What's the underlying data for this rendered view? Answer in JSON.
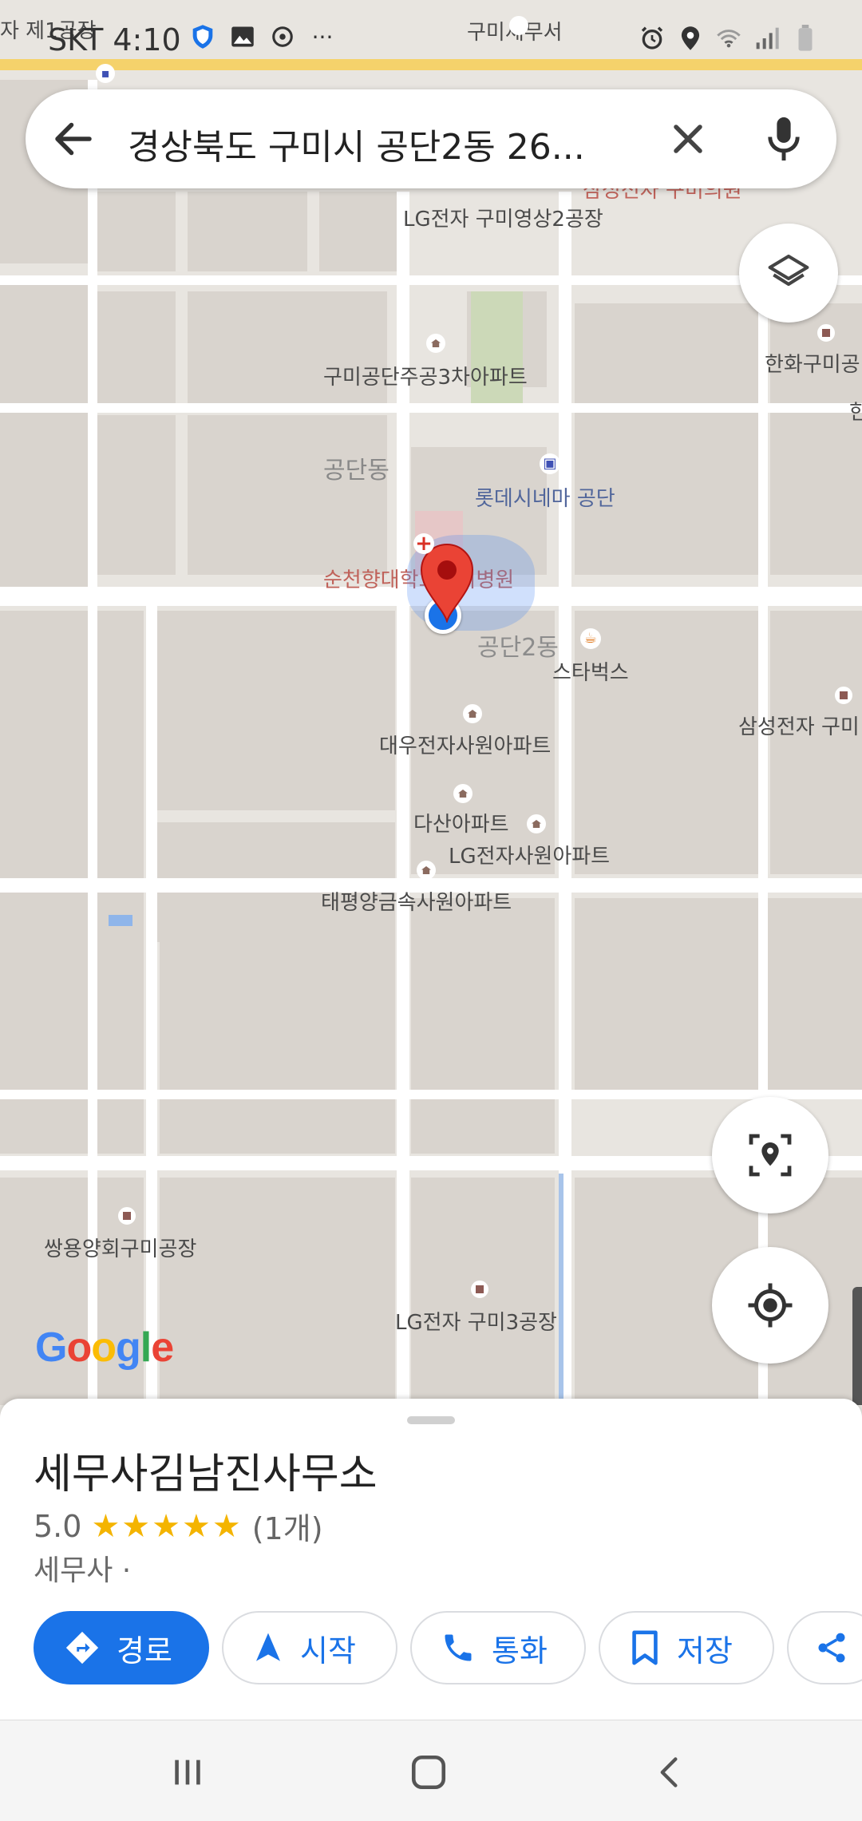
{
  "status_bar": {
    "carrier_time": "SKT 4:10",
    "more": "···"
  },
  "search": {
    "query": "경상북도 구미시 공단2동 26..."
  },
  "map": {
    "labels": {
      "tax_office": "구미세무서",
      "factory1": "자 제1공장",
      "lg_video2": "LG전자 구미영상2공장",
      "hanwha": "한화구미공",
      "han": "한",
      "apt3": "구미공단주공3차아파트",
      "gongdan_dong": "공단동",
      "lotte": "롯데시네마 공단",
      "hospital": "순천향대학교구미병원",
      "gongdan2": "공단2동",
      "starbucks": "스타벅스",
      "samsung": "삼성전자 구미",
      "daewoo": "대우전자사원아파트",
      "dasan": "다산아파트",
      "lg_apt": "LG전자사원아파트",
      "taepyeong": "태평양금속사원아파트",
      "ssangyong": "쌍용양회구미공장",
      "lg_factory3": "LG전자 구미3공장",
      "top_red": "삼성전자 구미의원"
    },
    "google_logo": "Google"
  },
  "place": {
    "name": "세무사김남진사무소",
    "rating": "5.0",
    "stars": "★★★★★",
    "review_count": "(1개)",
    "category": "세무사 ·"
  },
  "actions": {
    "directions": "경로",
    "start": "시작",
    "call": "통화",
    "save": "저장"
  },
  "colors": {
    "accent": "#1a73e8",
    "star": "#f4b400",
    "pin": "#ea4335"
  }
}
